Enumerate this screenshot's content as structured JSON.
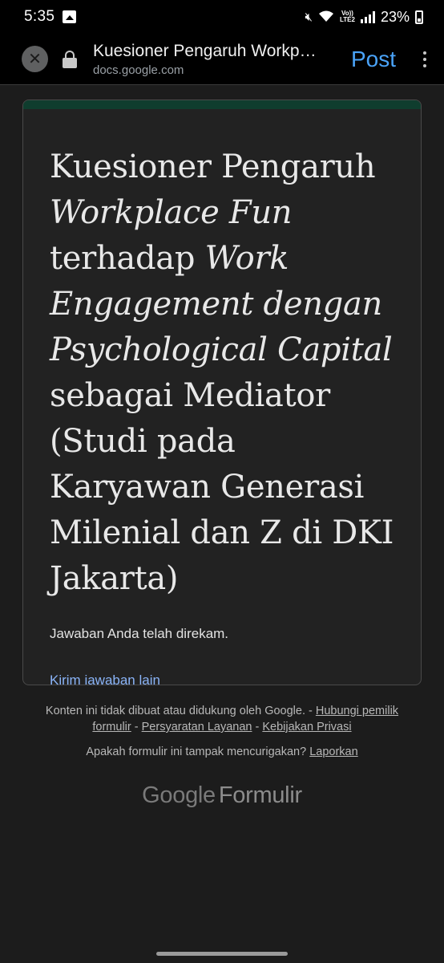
{
  "status_bar": {
    "time": "5:35",
    "lte_top": "Vo))",
    "lte_bottom": "LTE2",
    "battery_percent": "23%"
  },
  "toolbar": {
    "title": "Kuesioner Pengaruh Workplace Fun terhadap Work Engagement dengan Psychological Capital sebagai Mediator",
    "url": "docs.google.com",
    "post_label": "Post",
    "close_glyph": "✕"
  },
  "form": {
    "title_parts": {
      "p1": "Kuesioner Pengaruh ",
      "p2": "Workplace Fun",
      "p3": " terhadap ",
      "p4": "Work Engagement dengan Psychological Capital",
      "p5": " sebagai Mediator (Studi pada Karyawan Generasi Milenial dan Z di DKI Jakarta)"
    },
    "confirmation": "Jawaban Anda telah direkam.",
    "another_response_link": "Kirim jawaban lain"
  },
  "footer": {
    "disclaimer": "Konten ini tidak dibuat atau didukung oleh Google. - ",
    "contact_owner": "Hubungi pemilik formulir",
    "sep1": " - ",
    "terms": "Persyaratan Layanan",
    "sep2": " - ",
    "privacy": "Kebijakan Privasi",
    "suspicious_question": "Apakah formulir ini tampak mencurigakan? ",
    "report_link": "Laporkan",
    "brand_google": "Google",
    "brand_product": "Formulir"
  },
  "colors": {
    "accent_header": "#0f3d2e",
    "link": "#8ab4f8",
    "post_button": "#4aa3f8"
  }
}
